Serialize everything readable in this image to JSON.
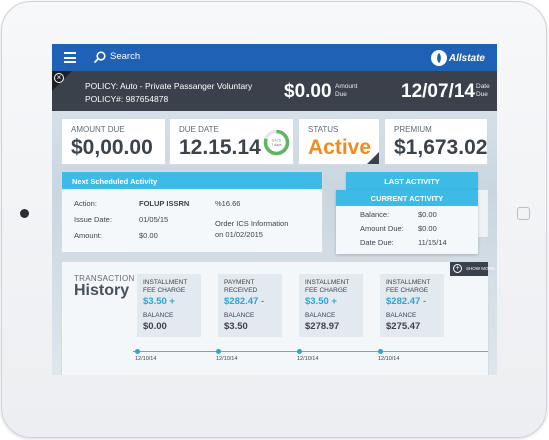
{
  "header": {
    "search_label": "Search",
    "brand_name": "Allstate"
  },
  "policy": {
    "line1": "POLICY: Auto - Private Passanger Voluntary",
    "line2": "POLICY#:  987654878",
    "amount_due": "$0.00",
    "amount_due_label_1": "Amount",
    "amount_due_label_2": "Due",
    "due_date": "12/07/14",
    "due_date_label_1": "Date",
    "due_date_label_2": "Due"
  },
  "cards": {
    "amount_due_label": "AMOUNT DUE",
    "amount_due_value": "$0,00.00",
    "due_date_label": "DUE DATE",
    "due_date_value": "12.15.14",
    "days_label": "DAYS",
    "days_value": "7 days",
    "days_fraction": 0.8,
    "status_label": "STATUS",
    "status_value": "Active",
    "premium_label": "PREMIUM",
    "premium_value": "$1,673.02"
  },
  "next_activity": {
    "title": "Next Scheduled Activity",
    "action_label": "Action:",
    "action_value": "FOLUP ISSRN",
    "percent": "%16.66",
    "issue_date_label": "Issue Date:",
    "issue_date_value": "01/05/15",
    "amount_label": "Amount:",
    "amount_value": "$0.00",
    "note_line1": "Order ICS Information",
    "note_line2": "on 01/02/2015"
  },
  "last_activity": {
    "title": "LAST ACTIVITY"
  },
  "current_activity": {
    "title": "CURRENT ACTIVITY",
    "balance_label": "Balance:",
    "balance_value": "$0.00",
    "amount_due_label": "Amount Due:",
    "amount_due_value": "$0.00",
    "date_due_label": "Date Due:",
    "date_due_value": "11/15/14"
  },
  "history": {
    "title_small": "TRANSACTION",
    "title_big": "History",
    "show_more": "SHOW MORE",
    "transactions": [
      {
        "type1": "INSTALLMENT",
        "type2": "FEE CHARGE",
        "amount": "$3.50 +",
        "balance_label": "BALANCE",
        "balance": "$0.00",
        "date": "12/10/14"
      },
      {
        "type1": "PAYMENT",
        "type2": "RECEIVED",
        "amount": "$282.47 -",
        "balance_label": "BALANCE",
        "balance": "$3.50",
        "date": "12/10/14"
      },
      {
        "type1": "INSTALLMENT",
        "type2": "FEE CHARGE",
        "amount": "$3.50 +",
        "balance_label": "BALANCE",
        "balance": "$278.97",
        "date": "12/10/14"
      },
      {
        "type1": "INSTALLMENT",
        "type2": "FEE CHARGE",
        "amount": "$282.47 -",
        "balance_label": "BALANCE",
        "balance": "$275.47",
        "date": "12/10/14"
      }
    ]
  },
  "colors": {
    "topbar": "#1f61b5",
    "policybar": "#3a414a",
    "accent": "#3cbbe6",
    "status_active": "#f08c1e",
    "donut": "#5cb85c"
  }
}
